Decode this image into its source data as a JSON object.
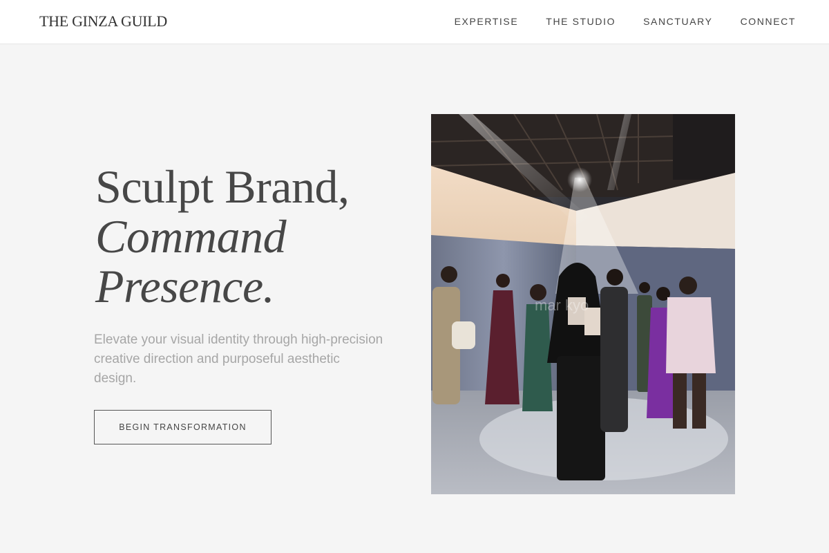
{
  "header": {
    "logo": "THE GINZA GUILD",
    "nav": [
      "EXPERTISE",
      "THE STUDIO",
      "SANCTUARY",
      "CONNECT"
    ]
  },
  "hero": {
    "title_line1": "Sculpt Brand,",
    "title_line2": "Command",
    "title_line3": "Presence.",
    "subtitle": "Elevate your visual identity through high-precision creative direction and purposeful aesthetic design.",
    "cta_label": "BEGIN TRANSFORMATION"
  },
  "photo": {
    "watermark": "mar   kyo"
  },
  "colors": {
    "background": "#f5f5f5",
    "header_bg": "#ffffff",
    "text_dark": "#444444",
    "subtitle": "#a6a6a6"
  }
}
